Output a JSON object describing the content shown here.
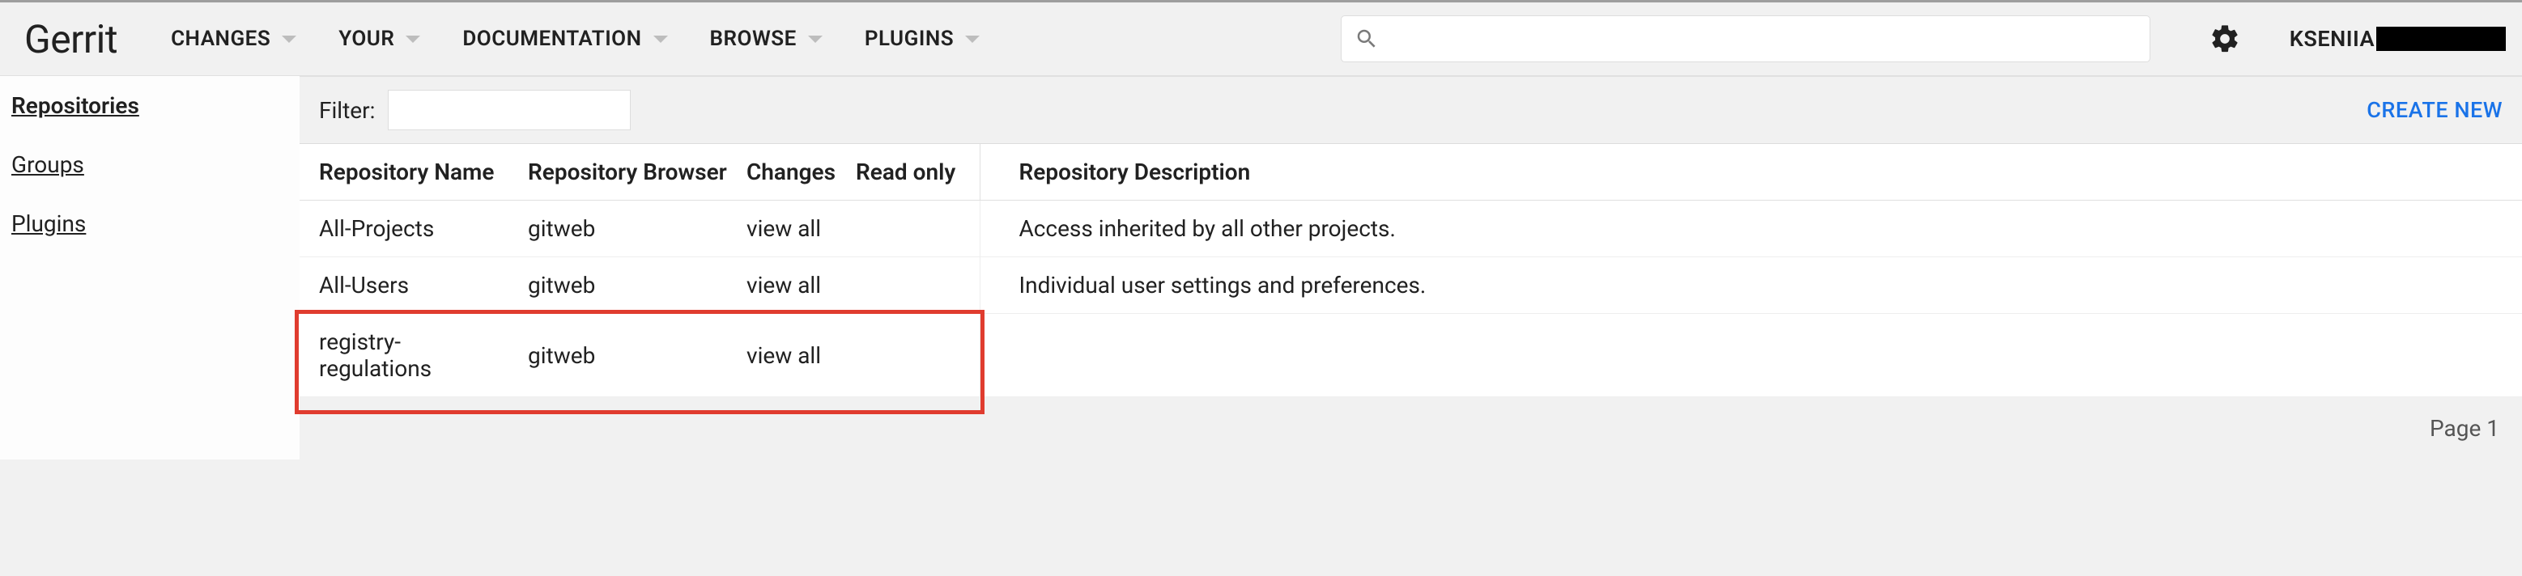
{
  "header": {
    "brand": "Gerrit",
    "nav": [
      {
        "label": "CHANGES"
      },
      {
        "label": "YOUR"
      },
      {
        "label": "DOCUMENTATION"
      },
      {
        "label": "BROWSE"
      },
      {
        "label": "PLUGINS"
      }
    ],
    "search_placeholder": "",
    "username": "KSENIIA"
  },
  "sidebar": {
    "items": [
      {
        "label": "Repositories",
        "active": true
      },
      {
        "label": "Groups",
        "active": false
      },
      {
        "label": "Plugins",
        "active": false
      }
    ]
  },
  "filter": {
    "label": "Filter:",
    "value": "",
    "create_new": "CREATE NEW"
  },
  "table": {
    "headers": {
      "name": "Repository Name",
      "browser": "Repository Browser",
      "changes": "Changes",
      "readonly": "Read only",
      "desc": "Repository Description"
    },
    "rows": [
      {
        "name": "All-Projects",
        "browser": "gitweb",
        "changes": "view all",
        "readonly": "",
        "desc": "Access inherited by all other projects."
      },
      {
        "name": "All-Users",
        "browser": "gitweb",
        "changes": "view all",
        "readonly": "",
        "desc": "Individual user settings and preferences."
      },
      {
        "name": "registry-regulations",
        "browser": "gitweb",
        "changes": "view all",
        "readonly": "",
        "desc": ""
      }
    ]
  },
  "pager": {
    "text": "Page 1"
  },
  "highlight_row_index": 2
}
